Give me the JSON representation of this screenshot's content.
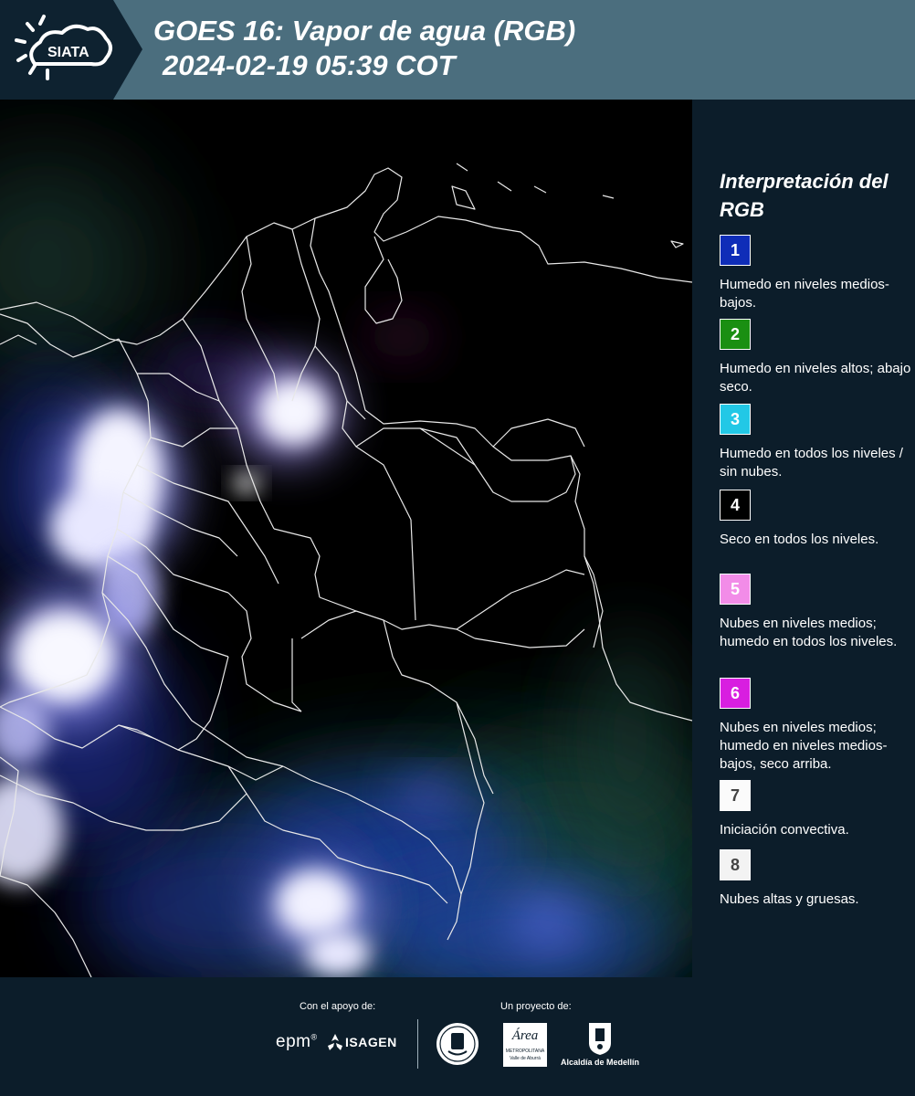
{
  "header": {
    "logo_text": "SIATA",
    "title_line1": "GOES 16: Vapor de agua (RGB)",
    "title_line2": "2024-02-19 05:39 COT"
  },
  "legend": {
    "title": "Interpretación del RGB",
    "items": [
      {
        "number": "1",
        "color": "#0f2db8",
        "text_color": "#ffffff",
        "description": "Humedo en niveles medios-bajos."
      },
      {
        "number": "2",
        "color": "#1a8f12",
        "text_color": "#ffffff",
        "description": "Humedo en niveles altos; abajo seco."
      },
      {
        "number": "3",
        "color": "#22c8e6",
        "text_color": "#ffffff",
        "description": "Humedo en todos los niveles / sin nubes."
      },
      {
        "number": "4",
        "color": "#000000",
        "text_color": "#ffffff",
        "description": "Seco en todos los niveles."
      },
      {
        "number": "5",
        "color": "#f28ce8",
        "text_color": "#ffffff",
        "description": "Nubes en niveles medios; humedo en todos los niveles."
      },
      {
        "number": "6",
        "color": "#d81ee0",
        "text_color": "#ffffff",
        "description": "Nubes en niveles medios; humedo en niveles medios-bajos, seco arriba."
      },
      {
        "number": "7",
        "color": "#fbfbfb",
        "text_color": "#444444",
        "description": "Iniciación convectiva."
      },
      {
        "number": "8",
        "color": "#f3f3f3",
        "text_color": "#444444",
        "description": "Nubes altas y gruesas."
      }
    ]
  },
  "footer": {
    "support_label": "Con el apoyo de:",
    "project_label": "Un proyecto de:",
    "sponsor_epm": "epm",
    "sponsor_isagen": "ISAGEN",
    "sponsor_area_title": "Área",
    "sponsor_area_sub": "METROPOLITANA",
    "sponsor_area_sub2": "Valle de Aburrá",
    "sponsor_alcaldia": "Alcaldía de Medellín"
  }
}
